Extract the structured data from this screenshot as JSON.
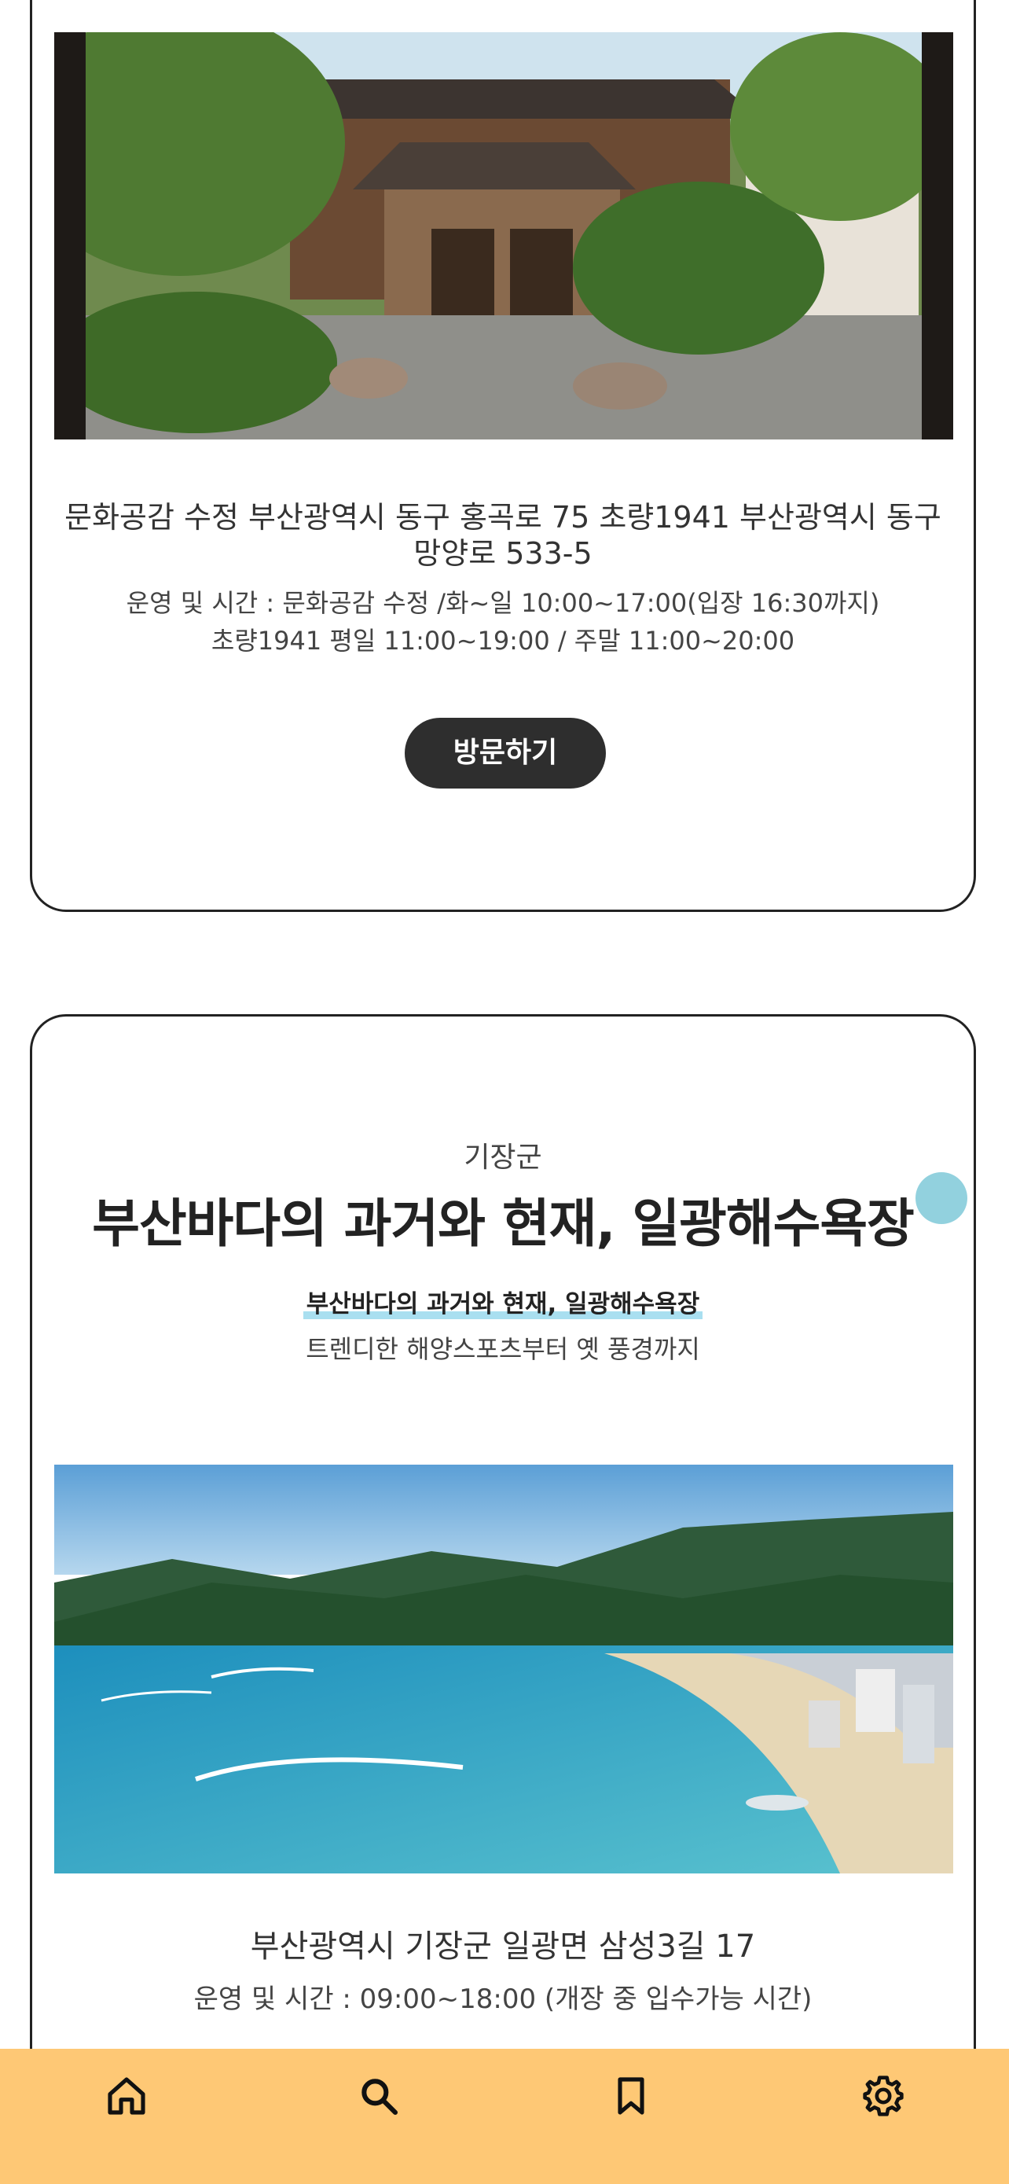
{
  "cards": [
    {
      "address": "문화공감 수정 부산광역시 동구 홍곡로 75 초량1941 부산광역시 동구 망양로 533-5",
      "hours_line1": "운영 및 시간 : 문화공감 수정 /화~일 10:00~17:00(입장 16:30까지)",
      "hours_line2": "초량1941 평일 11:00~19:00 / 주말 11:00~20:00",
      "visit_label": "방문하기",
      "image": "japanese-style-wooden-house-garden-photo"
    },
    {
      "region": "기장군",
      "title": "부산바다의 과거와 현재, 일광해수욕장",
      "subtitle": "부산바다의 과거와 현재, 일광해수욕장",
      "description": "트렌디한 해양스포츠부터 옛 풍경까지",
      "image": "ilgwang-beach-aerial-photo",
      "address": "부산광역시 기장군 일광면 삼성3길 17",
      "hours": "운영 및 시간 : 09:00~18:00 (개장 중 입수가능 시간)"
    }
  ],
  "tabbar": {
    "background": "#fec875",
    "tabs": [
      {
        "icon": "home-icon"
      },
      {
        "icon": "search-icon"
      },
      {
        "icon": "bookmark-icon"
      },
      {
        "icon": "gear-icon"
      }
    ]
  }
}
